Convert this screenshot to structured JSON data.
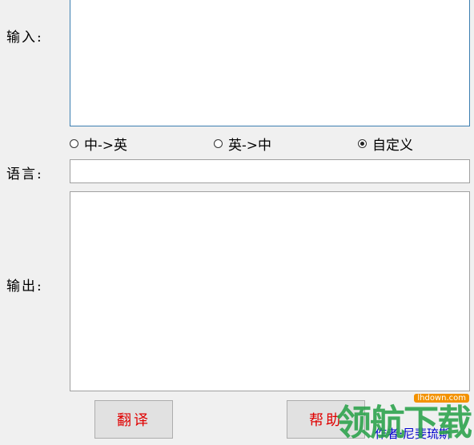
{
  "labels": {
    "input": "输入:",
    "language": "语言:",
    "output": "输出:"
  },
  "input": {
    "value": ""
  },
  "language": {
    "value": ""
  },
  "output": {
    "value": ""
  },
  "radios": [
    {
      "label": "中->英",
      "checked": false
    },
    {
      "label": "英->中",
      "checked": false
    },
    {
      "label": "自定义",
      "checked": true
    }
  ],
  "buttons": {
    "translate": "翻译",
    "help": "帮助"
  },
  "author": "作者:尼斐琉斯",
  "watermark": {
    "brand": "领航下载",
    "url": "lhdown.com"
  },
  "colors": {
    "button_text": "#e00000",
    "author_text": "#0000cc",
    "input_focus_border": "#3c7fb1"
  }
}
